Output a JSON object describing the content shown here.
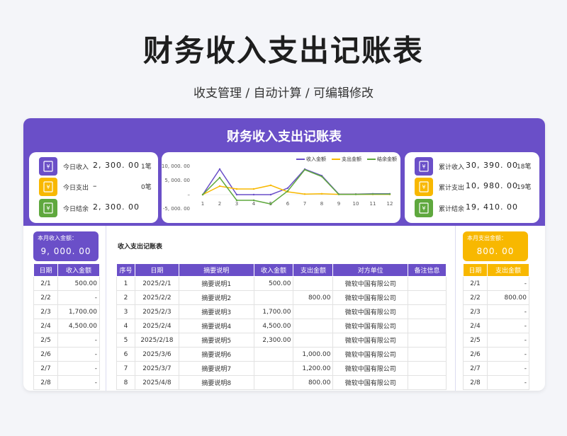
{
  "header": {
    "title": "财务收入支出记账表",
    "subtitle": "收支管理 / 自动计算 / 可编辑修改"
  },
  "banner_title": "财务收入支出记账表",
  "today": [
    {
      "label": "今日收入",
      "value": "2, 300. 00",
      "count": "1笔",
      "color": "#6a4fc8",
      "icon": "money-icon"
    },
    {
      "label": "今日支出",
      "value": "–",
      "count": "0笔",
      "color": "#f8b800",
      "icon": "money-icon"
    },
    {
      "label": "今日结余",
      "value": "2, 300. 00",
      "count": "",
      "color": "#5fa83e",
      "icon": "money-icon"
    }
  ],
  "cumulative": [
    {
      "label": "累计收入",
      "value": "30, 390. 00",
      "count": "18笔",
      "color": "#6a4fc8",
      "icon": "money-icon"
    },
    {
      "label": "累计支出",
      "value": "10, 980. 00",
      "count": "19笔",
      "color": "#f8b800",
      "icon": "money-icon"
    },
    {
      "label": "累计结余",
      "value": "19, 410. 00",
      "count": "",
      "color": "#5fa83e",
      "icon": "money-icon"
    }
  ],
  "chart_data": {
    "type": "line",
    "x": [
      1,
      2,
      3,
      4,
      5,
      6,
      7,
      8,
      9,
      10,
      11,
      12
    ],
    "ylim": [
      -5000,
      10000
    ],
    "yticks": [
      "10, 000. 00",
      "5, 000. 00",
      "–",
      "-5, 000. 00"
    ],
    "series": [
      {
        "name": "收入金额",
        "color": "#6a4fc8",
        "values": [
          0,
          9000,
          0,
          0,
          0,
          2300,
          9000,
          6700,
          200,
          200,
          300,
          300
        ]
      },
      {
        "name": "支出金额",
        "color": "#f8b800",
        "values": [
          0,
          3000,
          2000,
          2000,
          3300,
          1000,
          200,
          300,
          100,
          100,
          100,
          100
        ]
      },
      {
        "name": "结余金额",
        "color": "#5fa83e",
        "values": [
          0,
          6000,
          -2000,
          -2000,
          -3300,
          1300,
          8800,
          6400,
          100,
          100,
          200,
          200
        ]
      }
    ],
    "legend": "top-right",
    "grid": false
  },
  "left_panel": {
    "month_label": "本月收入金额：",
    "month_value": "9, 000. 00",
    "columns": [
      "日期",
      "收入金额"
    ],
    "rows": [
      [
        "2/1",
        "500.00"
      ],
      [
        "2/2",
        "-"
      ],
      [
        "2/3",
        "1,700.00"
      ],
      [
        "2/4",
        "4,500.00"
      ],
      [
        "2/5",
        "-"
      ],
      [
        "2/6",
        "-"
      ],
      [
        "2/7",
        "-"
      ],
      [
        "2/8",
        "-"
      ]
    ]
  },
  "right_panel": {
    "month_label": "本月支出金额：",
    "month_value": "800. 00",
    "columns": [
      "日期",
      "支出金额"
    ],
    "rows": [
      [
        "2/1",
        "-"
      ],
      [
        "2/2",
        "800.00"
      ],
      [
        "2/3",
        "-"
      ],
      [
        "2/4",
        "-"
      ],
      [
        "2/5",
        "-"
      ],
      [
        "2/6",
        "-"
      ],
      [
        "2/7",
        "-"
      ],
      [
        "2/8",
        "-"
      ]
    ]
  },
  "ledger": {
    "title": "收入支出记账表",
    "columns": [
      "序号",
      "日期",
      "摘要说明",
      "收入金额",
      "支出金额",
      "对方单位",
      "备注信息"
    ],
    "rows": [
      [
        "1",
        "2025/2/1",
        "摘要说明1",
        "500.00",
        "",
        "微软中国有限公司",
        ""
      ],
      [
        "2",
        "2025/2/2",
        "摘要说明2",
        "",
        "800.00",
        "微软中国有限公司",
        ""
      ],
      [
        "3",
        "2025/2/3",
        "摘要说明3",
        "1,700.00",
        "",
        "微软中国有限公司",
        ""
      ],
      [
        "4",
        "2025/2/4",
        "摘要说明4",
        "4,500.00",
        "",
        "微软中国有限公司",
        ""
      ],
      [
        "5",
        "2025/2/18",
        "摘要说明5",
        "2,300.00",
        "",
        "微软中国有限公司",
        ""
      ],
      [
        "6",
        "2025/3/6",
        "摘要说明6",
        "",
        "1,000.00",
        "微软中国有限公司",
        ""
      ],
      [
        "7",
        "2025/3/7",
        "摘要说明7",
        "",
        "1,200.00",
        "微软中国有限公司",
        ""
      ],
      [
        "8",
        "2025/4/8",
        "摘要说明8",
        "",
        "800.00",
        "微软中国有限公司",
        ""
      ]
    ]
  }
}
